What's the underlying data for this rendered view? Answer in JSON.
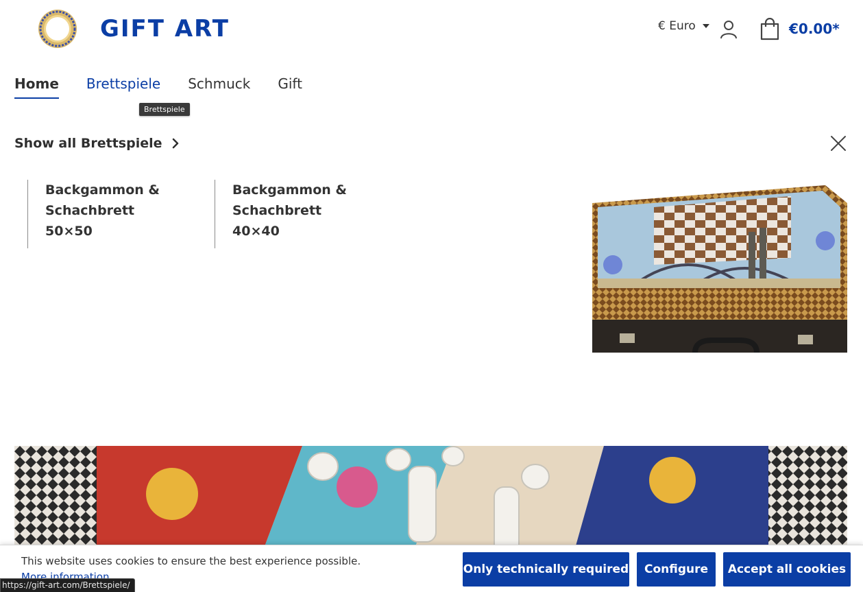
{
  "header": {
    "brand": "GIFT ART",
    "currency_label": "€ Euro",
    "cart_total": "€0.00*"
  },
  "nav": {
    "items": [
      {
        "label": "Home",
        "state": "active"
      },
      {
        "label": "Brettspiele",
        "state": "hover"
      },
      {
        "label": "Schmuck",
        "state": "normal"
      },
      {
        "label": "Gift",
        "state": "normal"
      }
    ],
    "tooltip": "Brettspiele"
  },
  "flyout": {
    "show_all": "Show all Brettspiele",
    "categories": [
      {
        "line1": "Backgammon &",
        "line2": "Schachbrett",
        "line3": "50×50"
      },
      {
        "line1": "Backgammon &",
        "line2": "Schachbrett",
        "line3": "40×40"
      }
    ]
  },
  "cookie": {
    "text": "This website uses cookies to ensure the best experience possible.",
    "more_info": "More information",
    "btn_technical": "Only technically required",
    "btn_configure": "Configure",
    "btn_accept": "Accept all cookies"
  },
  "status_url": "https://gift-art.com/Brettspiele/",
  "colors": {
    "brand_blue": "#0b3ea5",
    "text": "#2f2f2f"
  }
}
